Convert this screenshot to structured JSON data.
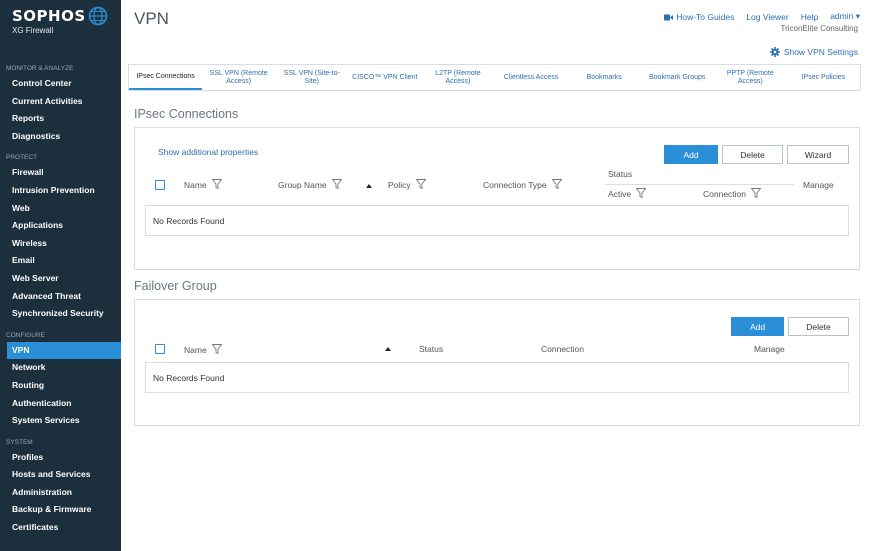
{
  "brand": {
    "name": "SOPHOS",
    "product": "XG Firewall"
  },
  "sidebar": {
    "sections": [
      {
        "title": "MONITOR & ANALYZE",
        "items": [
          "Control Center",
          "Current Activities",
          "Reports",
          "Diagnostics"
        ]
      },
      {
        "title": "PROTECT",
        "items": [
          "Firewall",
          "Intrusion Prevention",
          "Web",
          "Applications",
          "Wireless",
          "Email",
          "Web Server",
          "Advanced Threat",
          "Synchronized Security"
        ]
      },
      {
        "title": "CONFIGURE",
        "items": [
          "VPN",
          "Network",
          "Routing",
          "Authentication",
          "System Services"
        ]
      },
      {
        "title": "SYSTEM",
        "items": [
          "Profiles",
          "Hosts and Services",
          "Administration",
          "Backup & Firmware",
          "Certificates"
        ]
      }
    ],
    "active_item": "VPN"
  },
  "header": {
    "title": "VPN",
    "how_to": "How-To Guides",
    "log_viewer": "Log Viewer",
    "help": "Help",
    "admin": "admin",
    "company": "TriconElite Consulting",
    "settings_link": "Show VPN Settings"
  },
  "tabs": [
    "IPsec Connections",
    "SSL VPN (Remote Access)",
    "SSL VPN (Site-to-Site)",
    "CISCO™ VPN Client",
    "L2TP (Remote Access)",
    "Clientless Access",
    "Bookmarks",
    "Bookmark Groups",
    "PPTP (Remote Access)",
    "IPsec Policies"
  ],
  "active_tab": "IPsec Connections",
  "ipsec": {
    "heading": "IPsec Connections",
    "show_props": "Show additional properties",
    "add": "Add",
    "delete": "Delete",
    "wizard": "Wizard",
    "col_name": "Name",
    "col_group": "Group Name",
    "col_policy": "Policy",
    "col_conn_type": "Connection Type",
    "col_status": "Status",
    "col_active": "Active",
    "col_connection": "Connection",
    "col_manage": "Manage",
    "empty": "No Records Found"
  },
  "failover": {
    "heading": "Failover Group",
    "add": "Add",
    "delete": "Delete",
    "col_name": "Name",
    "col_status": "Status",
    "col_connection": "Connection",
    "col_manage": "Manage",
    "empty": "No Records Found"
  },
  "colors": {
    "sidebar_bg": "#1c2f3d",
    "accent": "#2b8fd8",
    "link": "#2b6fb5"
  }
}
